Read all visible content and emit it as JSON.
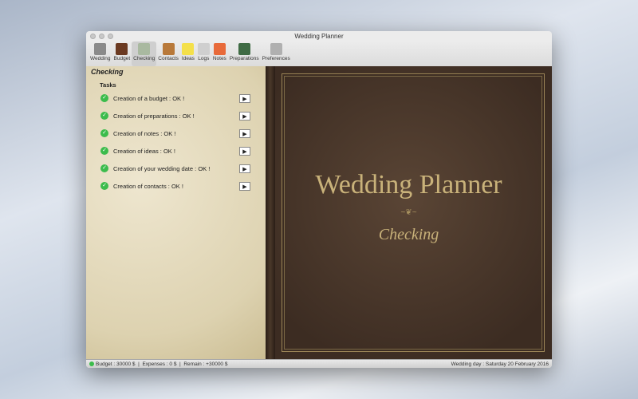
{
  "window": {
    "title": "Wedding Planner"
  },
  "toolbar": [
    {
      "label": "Wedding",
      "color": "#8a8a8a"
    },
    {
      "label": "Budget",
      "color": "#6b3a22"
    },
    {
      "label": "Checking",
      "color": "#a9b9a0"
    },
    {
      "label": "Contacts",
      "color": "#b8793a"
    },
    {
      "label": "Ideas",
      "color": "#f4e04a"
    },
    {
      "label": "Logs",
      "color": "#cfcfcf"
    },
    {
      "label": "Notes",
      "color": "#e86a3a"
    },
    {
      "label": "Preparations",
      "color": "#3f6b44"
    },
    {
      "label": "Preferences",
      "color": "#b0b0b0"
    }
  ],
  "panel": {
    "title": "Checking",
    "section": "Tasks",
    "tasks": [
      "Creation of a budget : OK !",
      "Creation of preparations : OK !",
      "Creation of notes : OK !",
      "Creation of ideas : OK !",
      "Creation of your wedding date : OK !",
      "Creation of contacts : OK !"
    ]
  },
  "book": {
    "title": "Wedding Planner",
    "subtitle": "Checking"
  },
  "status": {
    "budget": "Budget : 30000 $",
    "expenses": "Expenses : 0 $",
    "remain": "Remain : +30000 $",
    "wedding_day": "Wedding day : Saturday 20 February 2016"
  }
}
